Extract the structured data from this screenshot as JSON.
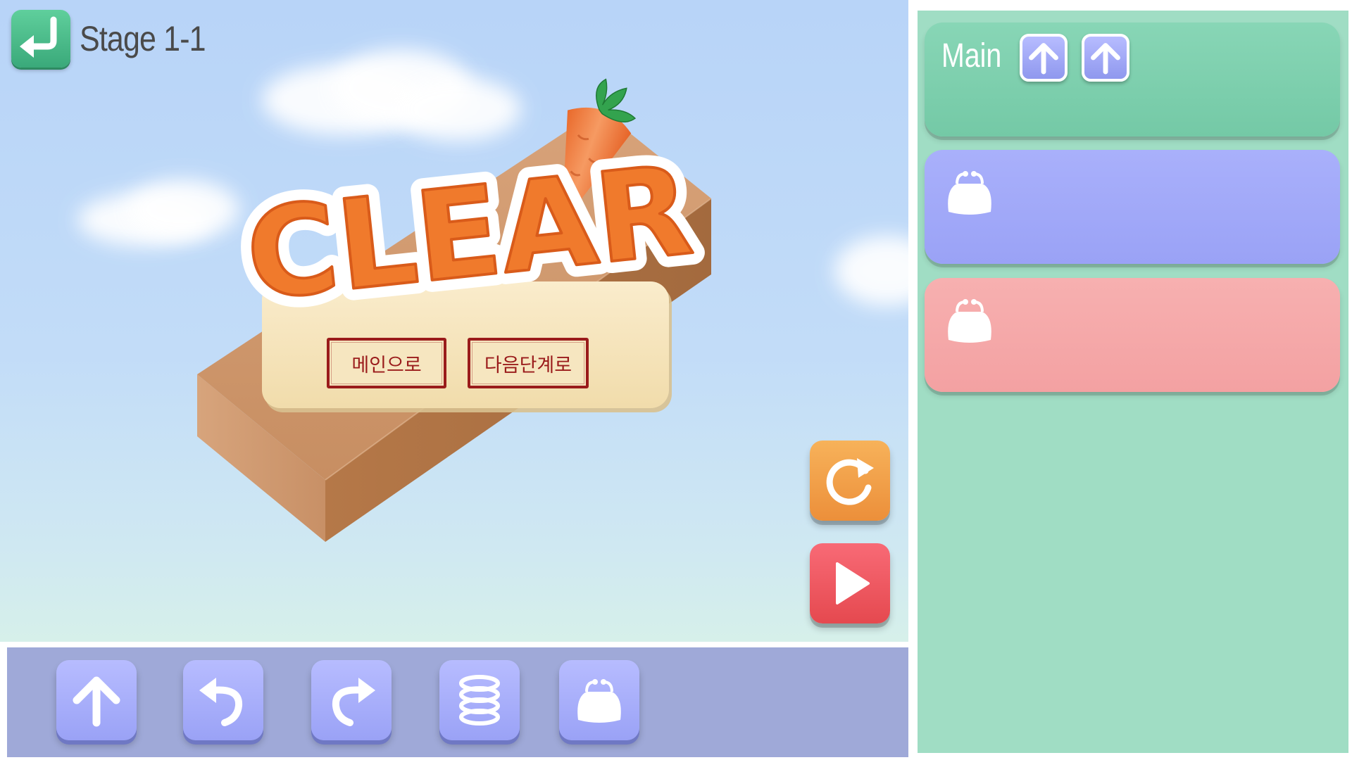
{
  "header": {
    "back_icon": "return-arrow-icon",
    "stage_title": "Stage 1-1"
  },
  "clear_popup": {
    "title": "CLEAR",
    "to_main_label": "메인으로",
    "next_stage_label": "다음단계로"
  },
  "controls": {
    "reset_icon": "rotate-clockwise-icon",
    "play_icon": "play-triangle-icon"
  },
  "command_palette": [
    {
      "icon": "forward-arrow-icon"
    },
    {
      "icon": "turn-left-icon"
    },
    {
      "icon": "turn-right-icon"
    },
    {
      "icon": "spring-jump-icon"
    },
    {
      "icon": "purse-icon"
    }
  ],
  "program": {
    "main": {
      "label": "Main",
      "commands": [
        "forward-arrow-icon",
        "forward-arrow-icon"
      ]
    },
    "function_1": {
      "icon": "purse-icon",
      "commands": []
    },
    "function_2": {
      "icon": "purse-icon",
      "commands": []
    }
  },
  "colors": {
    "sky": "#b8d4f8",
    "panel": "#a0ddc4",
    "main_slot": "#7ccdab",
    "function_1_slot": "#9aa2f6",
    "function_2_slot": "#f3a1a2",
    "command_button": "#a3aaf8",
    "clear_text": "#f07a2c",
    "back_button": "#49bd88",
    "reset_button": "#ef9a42",
    "play_button": "#e9525a"
  }
}
